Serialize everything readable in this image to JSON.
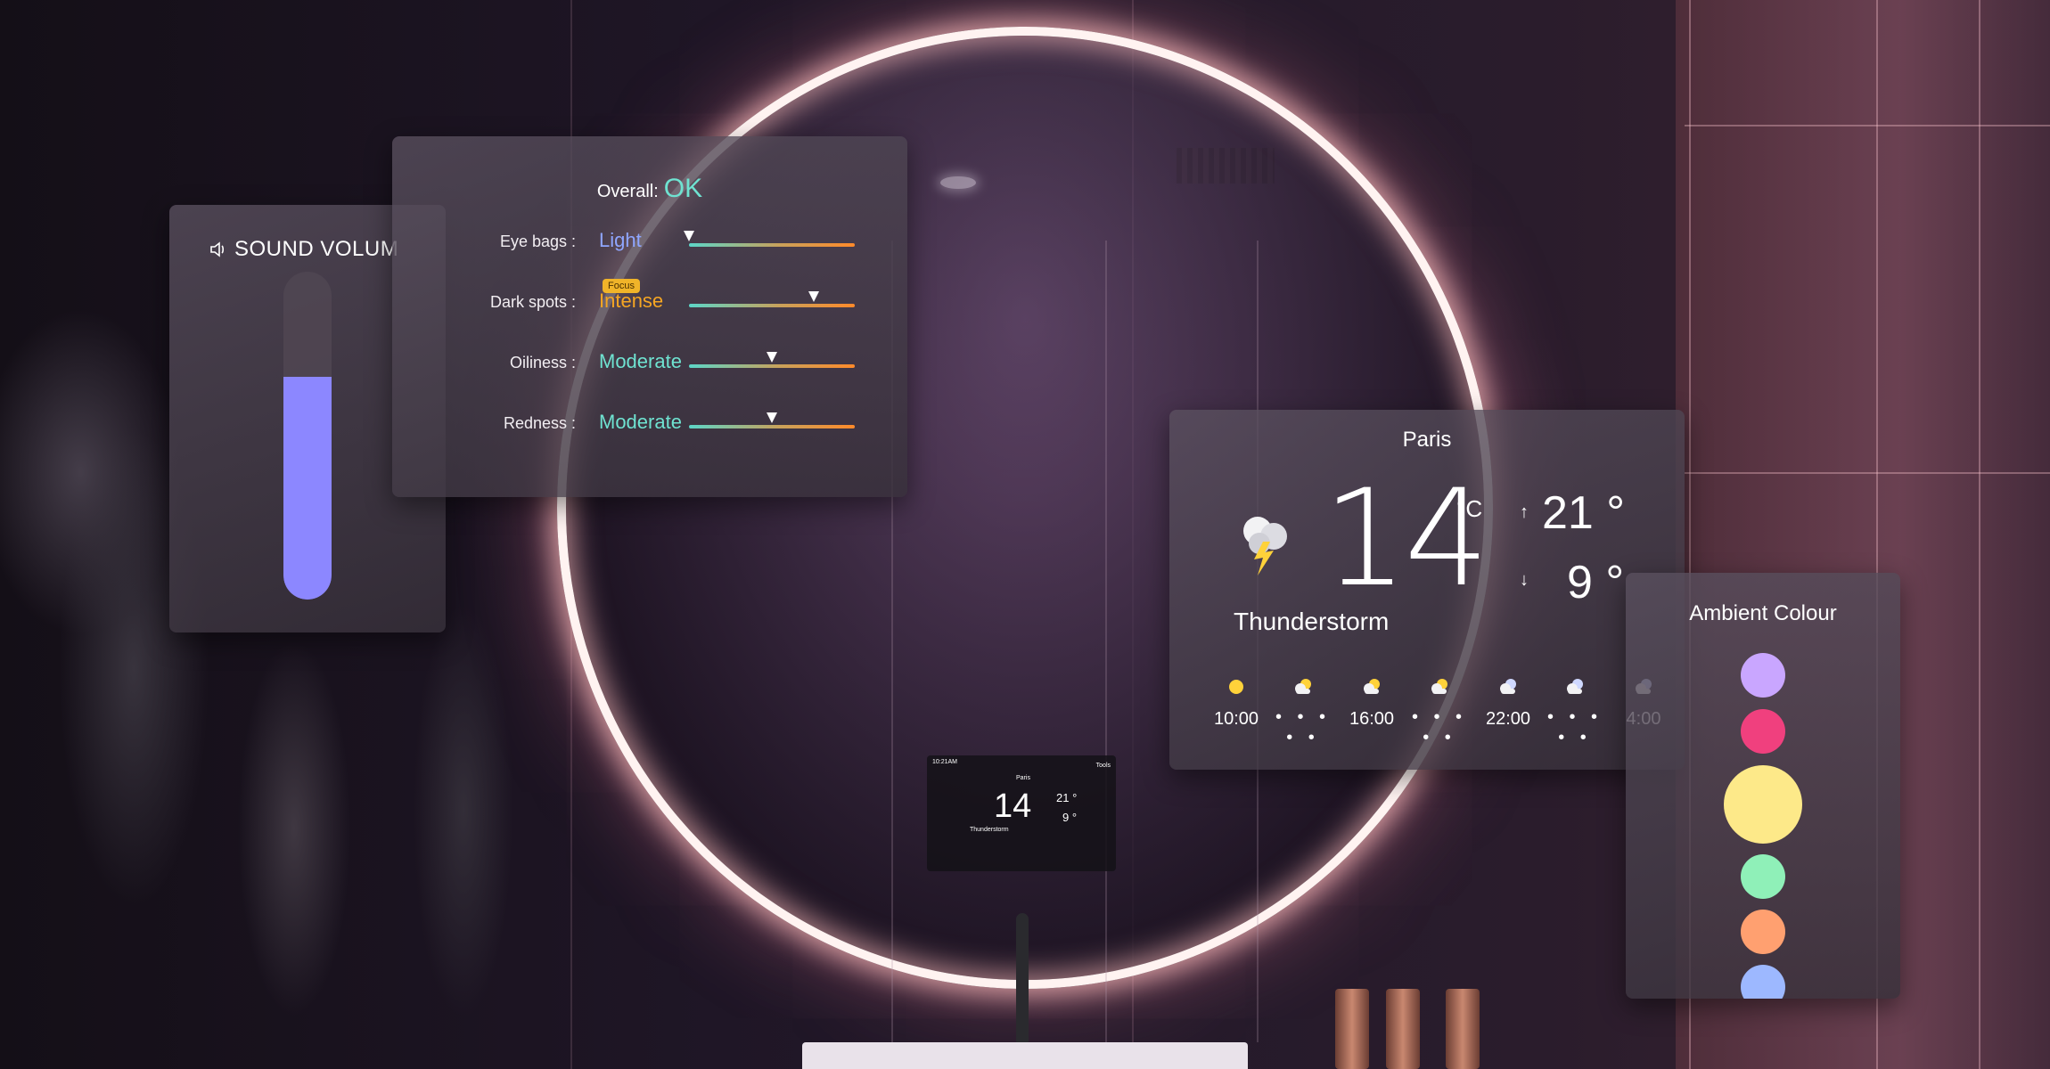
{
  "sound": {
    "title": "SOUND VOLUM",
    "icon": "speaker-icon",
    "level_fraction": 0.68,
    "fill_color": "#8c87ff"
  },
  "skin": {
    "overall_label": "Overall:",
    "overall_value": "OK",
    "overall_color": "#6fe3d1",
    "metrics": [
      {
        "label": "Eye bags :",
        "value": "Light",
        "value_color": "#8fa6ff",
        "marker_fraction": 0.0
      },
      {
        "label": "Dark spots :",
        "value": "Intense",
        "value_color": "#f5a623",
        "marker_fraction": 0.75,
        "badge": "Focus"
      },
      {
        "label": "Oiliness :",
        "value": "Moderate",
        "value_color": "#6fe3d1",
        "marker_fraction": 0.5
      },
      {
        "label": "Redness :",
        "value": "Moderate",
        "value_color": "#6fe3d1",
        "marker_fraction": 0.5
      }
    ]
  },
  "weather": {
    "city": "Paris",
    "temp": "14",
    "unit": "°C",
    "condition": "Thunderstorm",
    "condition_icon": "thunderstorm-icon",
    "high": "21 °",
    "low": "9 °",
    "high_arrow": "↑",
    "low_arrow": "↓",
    "forecast": [
      {
        "time": "10:00",
        "icon": "sun-icon"
      },
      {
        "time": "",
        "icon": "partly-cloudy-icon"
      },
      {
        "time": "16:00",
        "icon": "partly-cloudy-icon"
      },
      {
        "time": "",
        "icon": "partly-cloudy-icon"
      },
      {
        "time": "22:00",
        "icon": "cloudy-night-icon"
      },
      {
        "time": "",
        "icon": "cloudy-night-icon"
      },
      {
        "time": "4:00",
        "icon": "cloudy-night-icon"
      }
    ],
    "separator": "• • • • •"
  },
  "ambient": {
    "title": "Ambient Colour",
    "swatches": [
      {
        "name": "lavender",
        "color": "#c9a6ff"
      },
      {
        "name": "pink",
        "color": "#f0407e"
      },
      {
        "name": "yellow",
        "color": "#fde989",
        "selected": true
      },
      {
        "name": "mint",
        "color": "#8ff0b8"
      },
      {
        "name": "peach",
        "color": "#ffa070"
      },
      {
        "name": "blue",
        "color": "#9db8ff"
      }
    ]
  },
  "mirror_preview": {
    "time": "10:21AM",
    "city": "Paris",
    "temp": "14",
    "condition": "Thunderstorm",
    "high": "21 °",
    "low": "9 °",
    "tools": "Tools"
  }
}
